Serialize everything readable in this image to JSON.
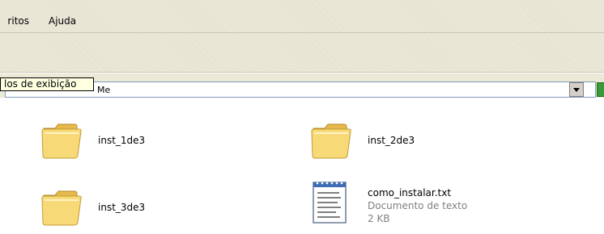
{
  "menu": {
    "favoritos_partial": "ritos",
    "ajuda": "Ajuda"
  },
  "address": {
    "value_visible": "Me"
  },
  "tooltip": {
    "text": "los de exibição"
  },
  "files": [
    {
      "name": "inst_1de3",
      "type": "folder",
      "icon": "folder-icon"
    },
    {
      "name": "inst_2de3",
      "type": "folder",
      "icon": "folder-icon"
    },
    {
      "name": "inst_3de3",
      "type": "folder",
      "icon": "folder-icon"
    },
    {
      "name": "como_instalar.txt",
      "description": "Documento de texto",
      "size": "2 KB",
      "type": "text",
      "icon": "text-document-icon"
    }
  ],
  "colors": {
    "chrome": "#ece9d8",
    "folder": "#f4d36a",
    "tooltip_bg": "#ffffe1",
    "go_green": "#3a9a3a"
  }
}
